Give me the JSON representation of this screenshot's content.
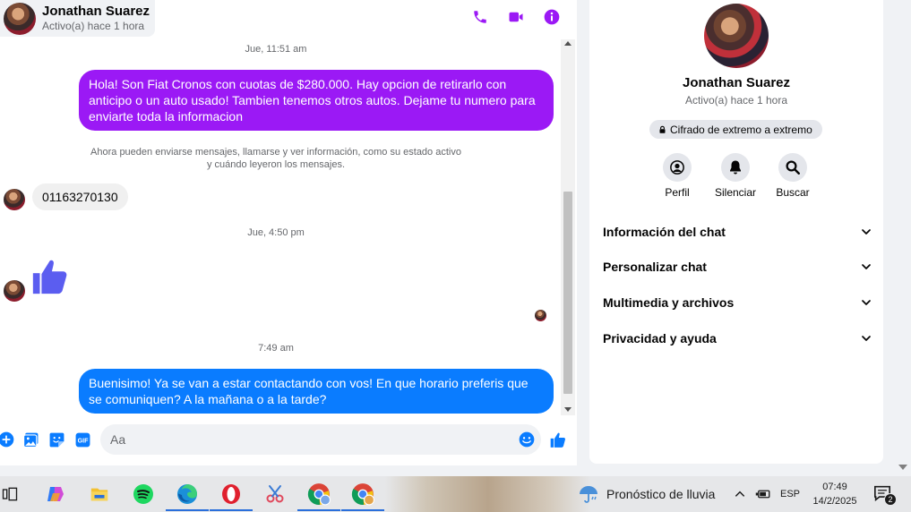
{
  "header": {
    "name": "Jonathan Suarez",
    "status": "Activo(a) hace 1 hora"
  },
  "messages": {
    "ts1": "Jue, 11:51 am",
    "out1": "Hola! Son Fiat Cronos con cuotas de $280.000. Hay opcion de retirarlo con anticipo o un auto usado! Tambien tenemos otros autos. Dejame tu numero para enviarte toda la informacion",
    "notice_line1": "Ahora pueden enviarse mensajes, llamarse y ver información, como su estado activo",
    "notice_line2": "y cuándo leyeron los mensajes.",
    "in1": "01163270130",
    "ts2": "Jue, 4:50 pm",
    "ts3": "7:49 am",
    "out2": "Buenisimo! Ya se van a estar contactando con vos! En que horario preferis que se comuniquen? A la mañana o a la tarde?"
  },
  "composer": {
    "placeholder": "Aa"
  },
  "info": {
    "name": "Jonathan Suarez",
    "status": "Activo(a) hace 1 hora",
    "encryption": "Cifrado de extremo a extremo",
    "actions": [
      {
        "label": "Perfil",
        "icon": "profile-icon"
      },
      {
        "label": "Silenciar",
        "icon": "bell-icon"
      },
      {
        "label": "Buscar",
        "icon": "search-icon"
      }
    ],
    "sections": [
      {
        "label": "Información del chat"
      },
      {
        "label": "Personalizar chat"
      },
      {
        "label": "Multimedia y archivos"
      },
      {
        "label": "Privacidad y ayuda"
      }
    ]
  },
  "taskbar": {
    "weather": "Pronóstico de lluvia",
    "language": "ESP",
    "time": "07:49",
    "date": "14/2/2025",
    "notifications": "2"
  },
  "colors": {
    "accent_purple": "#9b19f5",
    "accent_blue": "#0a7cff",
    "thumb_blue": "#5b5df0"
  }
}
